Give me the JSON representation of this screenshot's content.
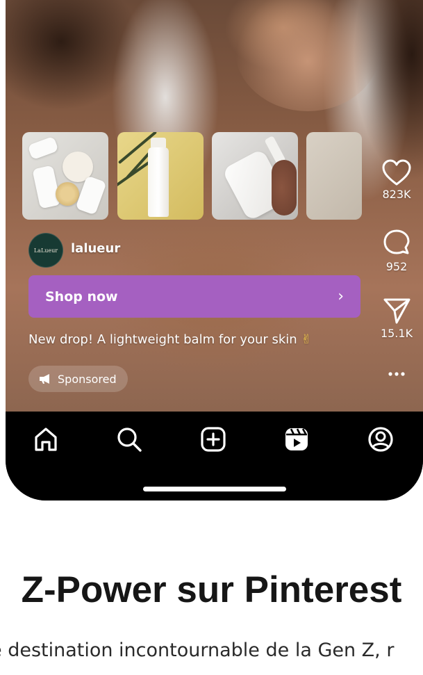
{
  "post": {
    "account": {
      "avatar_text": "LaLueur",
      "username": "lalueur"
    },
    "shop_button": {
      "label": "Shop now",
      "chevron": "›"
    },
    "caption": {
      "text": "New drop! A lightweight balm for your skin",
      "emoji": "✌"
    },
    "sponsored_label": "Sponsored",
    "actions": {
      "like_count": "823K",
      "comment_count": "952",
      "share_count": "15.1K",
      "more_icon": "more-icon"
    },
    "colors": {
      "shop_button": "#a560c1",
      "nav_background": "#000000"
    }
  },
  "nav": {
    "items": [
      {
        "name": "home",
        "icon": "home-icon"
      },
      {
        "name": "search",
        "icon": "search-icon"
      },
      {
        "name": "create",
        "icon": "plus-square-icon"
      },
      {
        "name": "reels",
        "icon": "reels-icon"
      },
      {
        "name": "profile",
        "icon": "profile-icon"
      }
    ]
  },
  "page": {
    "headline": "Z-Power sur Pinterest",
    "subtitle": "e destination incontournable de la Gen Z, r"
  }
}
